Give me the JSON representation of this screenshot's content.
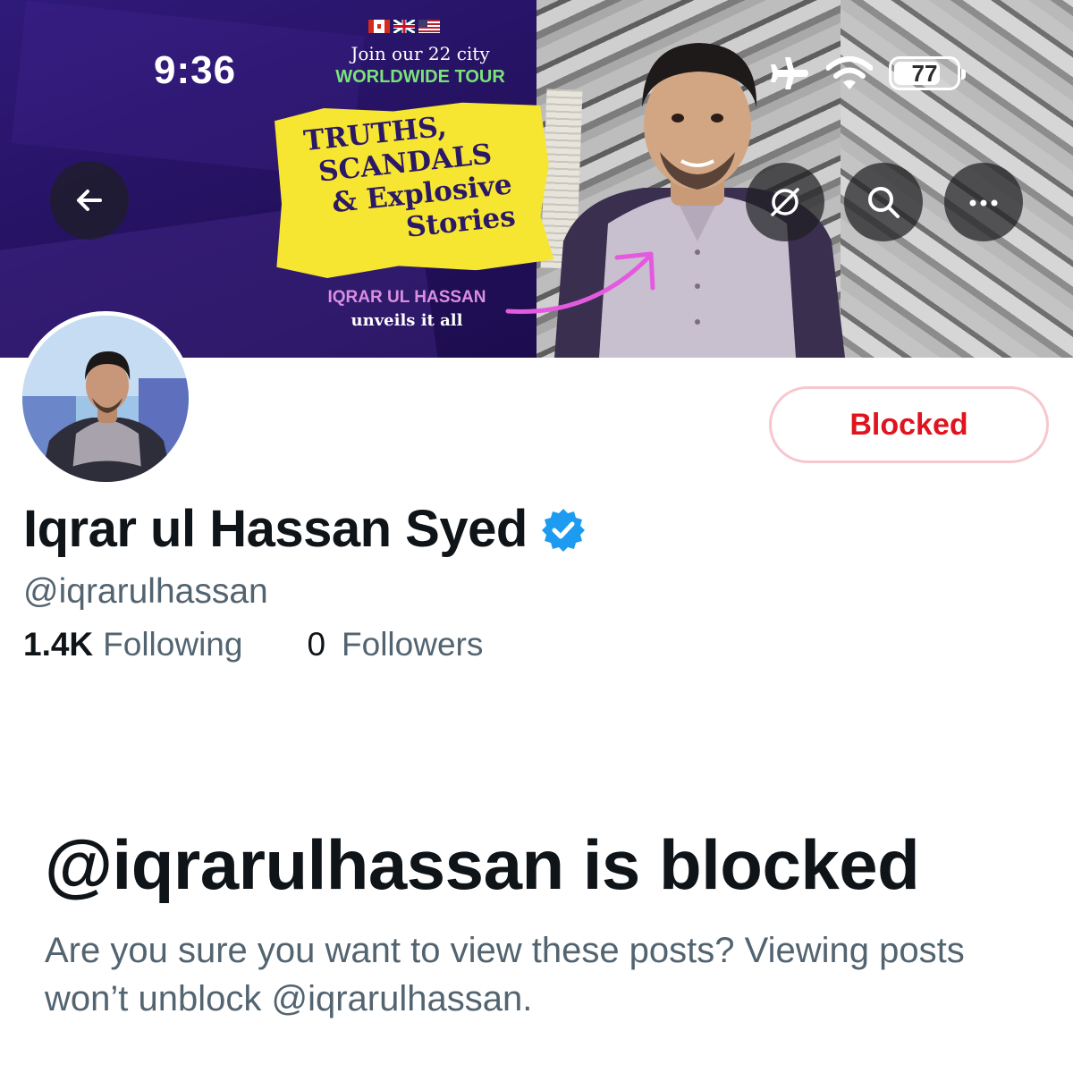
{
  "status_bar": {
    "time": "9:36",
    "battery": "77",
    "battery_level": 0.77
  },
  "banner": {
    "promo_line1": "Join our 22 city",
    "promo_line2": "WORLDWIDE TOUR",
    "headline": [
      "TRUTHS,",
      "SCANDALS",
      "& Explosive",
      "Stories"
    ],
    "host_name": "IQRAR UL HASSAN",
    "host_subline": "unveils it all",
    "colors": {
      "purple": "#2a1566",
      "sticker_yellow": "#f6e531",
      "tour_green": "#7be27a",
      "arrow_pink": "#e35adf"
    }
  },
  "header_buttons": {
    "back_icon": "arrow-left-icon",
    "grok_icon": "slashed-circle-icon",
    "search_icon": "search-icon",
    "more_icon": "ellipsis-icon"
  },
  "profile": {
    "display_name": "Iqrar ul Hassan Syed",
    "verified": true,
    "handle": "@iqrarulhassan",
    "following_count": "1.4K",
    "following_label": "Following",
    "followers_count": "0",
    "followers_label": "Followers",
    "blocked_button_label": "Blocked",
    "colors": {
      "blocked_red": "#e0141e",
      "verified_blue": "#1d9bf0",
      "secondary_text": "#536471"
    }
  },
  "blocked_notice": {
    "title": "@iqrarulhassan is blocked",
    "description": "Are you sure you want to view these posts? Viewing posts won’t unblock @iqrarulhassan."
  }
}
